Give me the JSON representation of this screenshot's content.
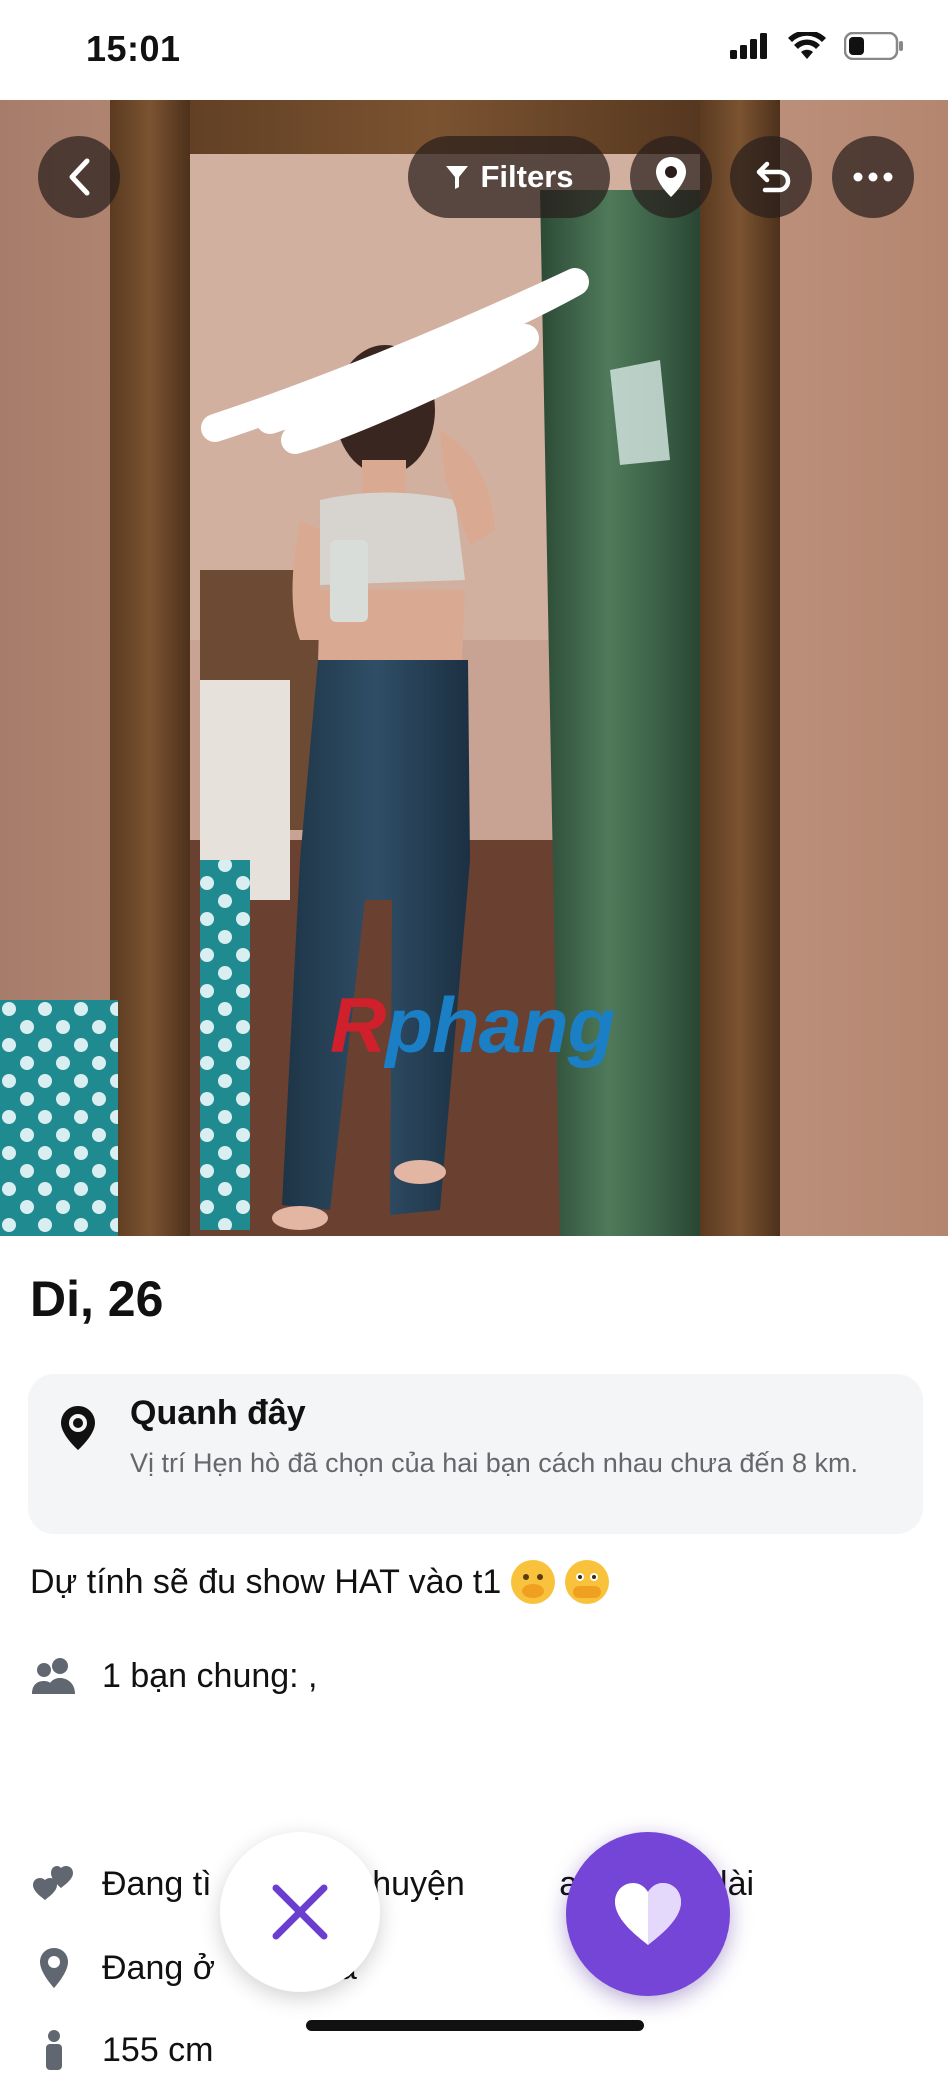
{
  "status_bar": {
    "time": "15:01",
    "icons": [
      "signal-icon",
      "wifi-icon",
      "battery-icon"
    ]
  },
  "top_controls": {
    "filters_label": "Filters",
    "icons": [
      "back-arrow-icon",
      "filter-icon",
      "location-pin-icon",
      "undo-icon",
      "more-icon"
    ]
  },
  "watermark": {
    "part1": "R",
    "part2": "phang"
  },
  "profile": {
    "name_age": "Di, 26",
    "location_title": "Quanh đây",
    "location_desc": "Vị trí Hẹn hò đã chọn của hai bạn cách nhau chưa đến 8 km.",
    "bio": "Dự tính sẽ đu show HAT vào t1",
    "mutual_friends": "1 bạn chung: ,",
    "looking_for": "Đang tì          trò chuyện          an hệ lâu dài",
    "lives_in": "Đang ở           oa",
    "height": "155 cm"
  },
  "actions": {
    "icons": [
      "close-icon",
      "heart-icon"
    ]
  },
  "colors": {
    "accent": "#7445d6",
    "dismiss_icon": "#6a3fd0",
    "card_bg": "#f3f5f7",
    "secondary_text": "#65676b"
  }
}
